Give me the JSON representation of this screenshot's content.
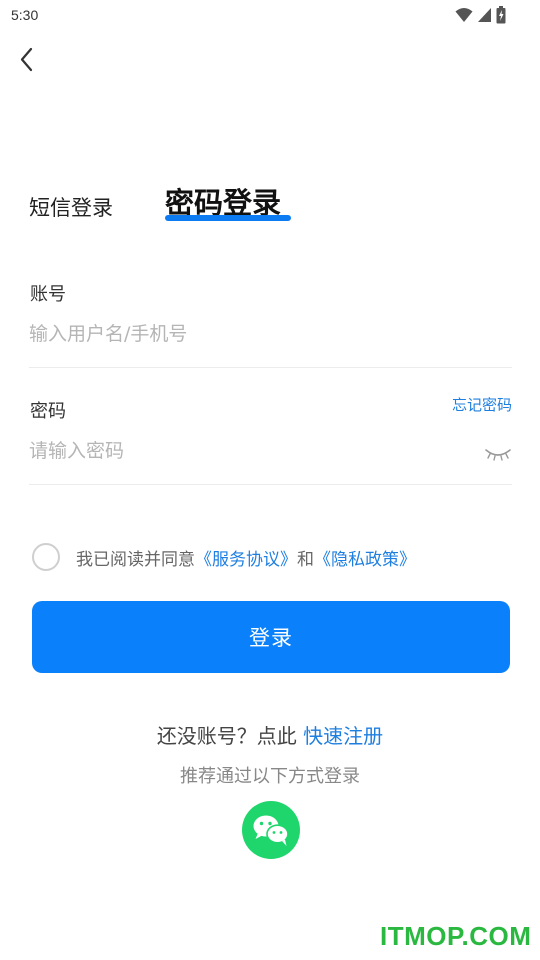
{
  "status_bar": {
    "time": "5:30"
  },
  "tabs": {
    "sms_login": "短信登录",
    "password_login": "密码登录"
  },
  "account": {
    "label": "账号",
    "placeholder": "输入用户名/手机号"
  },
  "password": {
    "label": "密码",
    "placeholder": "请输入密码",
    "forgot": "忘记密码"
  },
  "agreement": {
    "prefix": "我已阅读并同意",
    "service_link": "《服务协议》",
    "and": "和",
    "privacy_link": "《隐私政策》"
  },
  "login_button": "登录",
  "register": {
    "prompt": "还没账号？点此 ",
    "link": "快速注册"
  },
  "recommend": "推荐通过以下方式登录",
  "watermark": "ITMOP.COM",
  "colors": {
    "accent": "#0a80fa",
    "link": "#1f7fe0",
    "wechat": "#1fd66c",
    "watermark": "#2ab840"
  },
  "icons": [
    "back-arrow-icon",
    "wifi-icon",
    "signal-icon",
    "battery-icon",
    "eye-closed-icon",
    "wechat-icon"
  ]
}
